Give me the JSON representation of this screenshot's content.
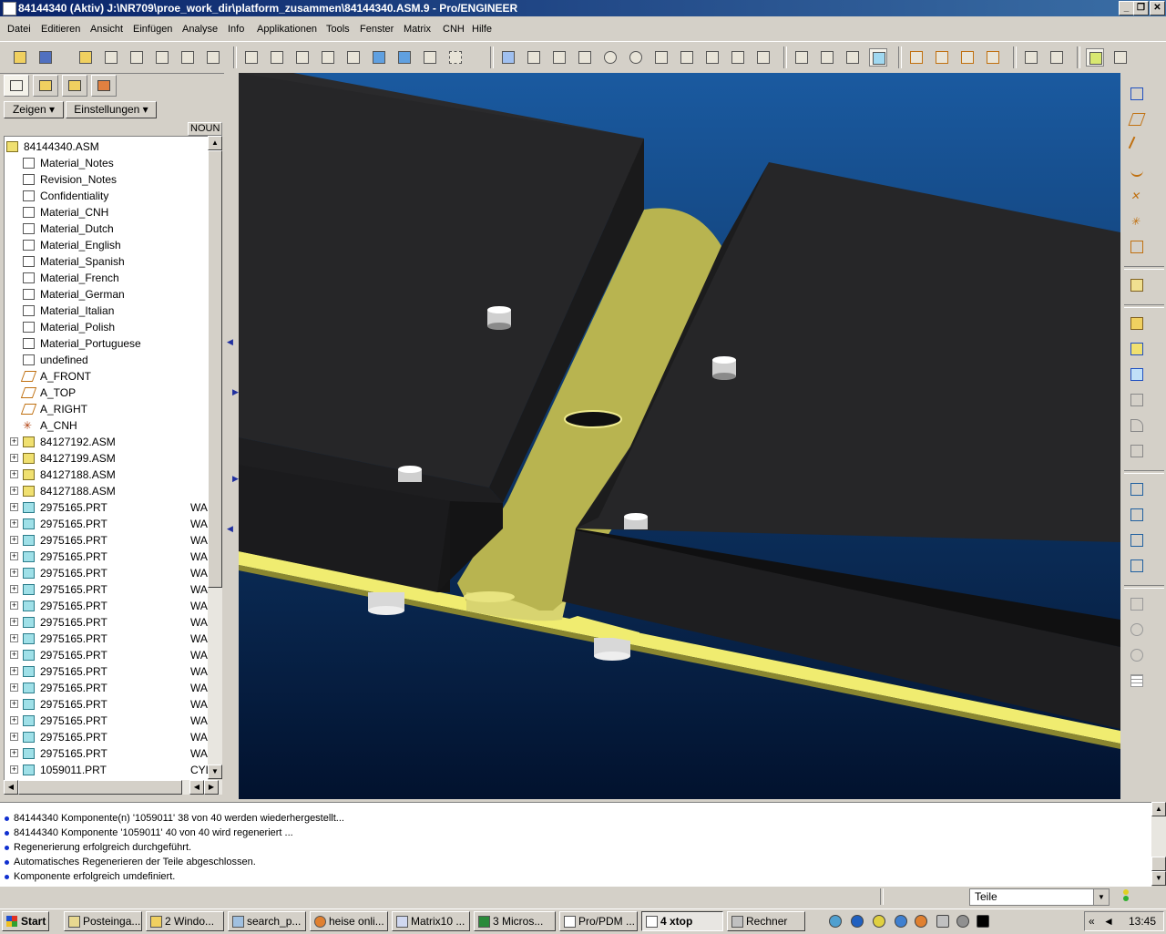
{
  "window": {
    "title": "84144340 (Aktiv) J:\\NR709\\proe_work_dir\\platform_zusammen\\84144340.ASM.9 - Pro/ENGINEER",
    "min_label": "_",
    "max_label": "❐",
    "close_label": "✕"
  },
  "menu": [
    "Datei",
    "Editieren",
    "Ansicht",
    "Einfügen",
    "Analyse",
    "Info",
    "Applikationen",
    "Tools",
    "Fenster",
    "Matrix",
    "CNH",
    "Hilfe"
  ],
  "panel": {
    "show_label": "Zeigen",
    "settings_label": "Einstellungen",
    "noun_header": "NOUN"
  },
  "tree": [
    {
      "label": "84144340.ASM",
      "type": "root",
      "noun": ""
    },
    {
      "label": "Material_Notes",
      "type": "note",
      "noun": ""
    },
    {
      "label": "Revision_Notes",
      "type": "note",
      "noun": ""
    },
    {
      "label": "Confidentiality",
      "type": "note",
      "noun": ""
    },
    {
      "label": "Material_CNH",
      "type": "note",
      "noun": ""
    },
    {
      "label": "Material_Dutch",
      "type": "note",
      "noun": ""
    },
    {
      "label": "Material_English",
      "type": "note",
      "noun": ""
    },
    {
      "label": "Material_Spanish",
      "type": "note",
      "noun": ""
    },
    {
      "label": "Material_French",
      "type": "note",
      "noun": ""
    },
    {
      "label": "Material_German",
      "type": "note",
      "noun": ""
    },
    {
      "label": "Material_Italian",
      "type": "note",
      "noun": ""
    },
    {
      "label": "Material_Polish",
      "type": "note",
      "noun": ""
    },
    {
      "label": "Material_Portuguese",
      "type": "note",
      "noun": ""
    },
    {
      "label": "undefined",
      "type": "note",
      "noun": ""
    },
    {
      "label": "A_FRONT",
      "type": "plane",
      "noun": ""
    },
    {
      "label": "A_TOP",
      "type": "plane",
      "noun": ""
    },
    {
      "label": "A_RIGHT",
      "type": "plane",
      "noun": ""
    },
    {
      "label": "A_CNH",
      "type": "csys",
      "noun": ""
    },
    {
      "label": "84127192.ASM",
      "type": "asm",
      "noun": ""
    },
    {
      "label": "84127199.ASM",
      "type": "asm",
      "noun": ""
    },
    {
      "label": "84127188.ASM",
      "type": "asm",
      "noun": ""
    },
    {
      "label": "84127188.ASM",
      "type": "asm",
      "noun": ""
    },
    {
      "label": "2975165.PRT",
      "type": "prt",
      "noun": "WA"
    },
    {
      "label": "2975165.PRT",
      "type": "prt",
      "noun": "WA"
    },
    {
      "label": "2975165.PRT",
      "type": "prt",
      "noun": "WA"
    },
    {
      "label": "2975165.PRT",
      "type": "prt",
      "noun": "WA"
    },
    {
      "label": "2975165.PRT",
      "type": "prt",
      "noun": "WA"
    },
    {
      "label": "2975165.PRT",
      "type": "prt",
      "noun": "WA"
    },
    {
      "label": "2975165.PRT",
      "type": "prt",
      "noun": "WA"
    },
    {
      "label": "2975165.PRT",
      "type": "prt",
      "noun": "WA"
    },
    {
      "label": "2975165.PRT",
      "type": "prt",
      "noun": "WA"
    },
    {
      "label": "2975165.PRT",
      "type": "prt",
      "noun": "WA"
    },
    {
      "label": "2975165.PRT",
      "type": "prt",
      "noun": "WA"
    },
    {
      "label": "2975165.PRT",
      "type": "prt",
      "noun": "WA"
    },
    {
      "label": "2975165.PRT",
      "type": "prt",
      "noun": "WA"
    },
    {
      "label": "2975165.PRT",
      "type": "prt",
      "noun": "WA"
    },
    {
      "label": "2975165.PRT",
      "type": "prt",
      "noun": "WA"
    },
    {
      "label": "2975165.PRT",
      "type": "prt",
      "noun": "WA"
    },
    {
      "label": "1059011.PRT",
      "type": "prt",
      "noun": "CYL"
    }
  ],
  "messages": [
    "84144340 Komponente(n) '1059011' 38 von 40 werden wiederhergestellt...",
    "84144340 Komponente '1059011' 40 von 40 wird regeneriert ...",
    "Regenerierung erfolgreich durchgeführt.",
    "Automatisches Regenerieren der Teile abgeschlossen.",
    "Komponente erfolgreich umdefiniert."
  ],
  "status": {
    "filter_value": "Teile"
  },
  "taskbar": {
    "start_label": "Start",
    "tasks": [
      {
        "label": "Posteinga...",
        "active": false
      },
      {
        "label": "2 Windo...",
        "active": false
      },
      {
        "label": "search_p...",
        "active": false
      },
      {
        "label": "heise onli...",
        "active": false
      },
      {
        "label": "Matrix10 ...",
        "active": false
      },
      {
        "label": "3 Micros...",
        "active": false
      },
      {
        "label": "Pro/PDM ...",
        "active": false
      },
      {
        "label": "4 xtop",
        "active": true
      },
      {
        "label": "Rechner",
        "active": false
      }
    ],
    "clock": "13:45"
  },
  "colors": {
    "viewport_top": "#1a5aa0",
    "viewport_bottom": "#02122e",
    "plate": "#262628",
    "bracket": "#b8b450",
    "rail": "#f0ec70"
  }
}
